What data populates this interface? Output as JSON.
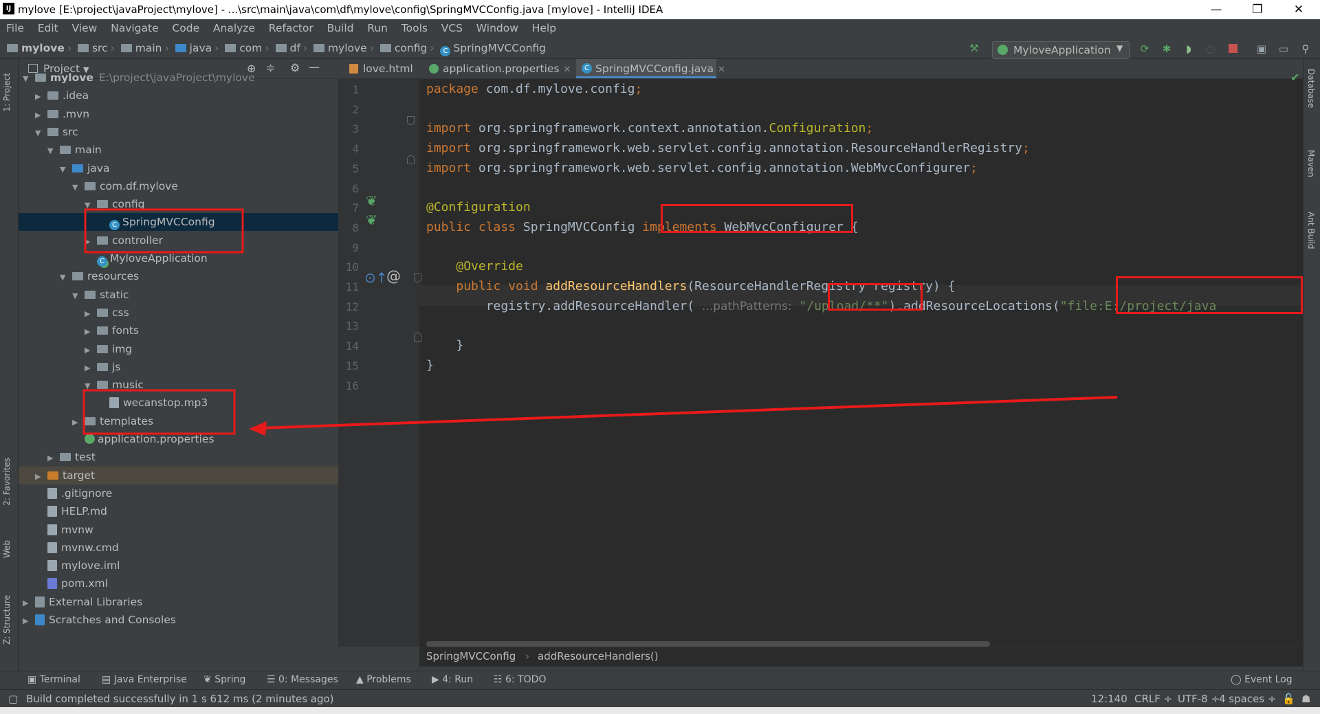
{
  "window": {
    "title": "mylove [E:\\project\\javaProject\\mylove] - ...\\src\\main\\java\\com\\df\\mylove\\config\\SpringMVCConfig.java [mylove] - IntelliJ IDEA",
    "minimize": "—",
    "restore": "❐",
    "close": "✕"
  },
  "menu": [
    "File",
    "Edit",
    "View",
    "Navigate",
    "Code",
    "Analyze",
    "Refactor",
    "Build",
    "Run",
    "Tools",
    "VCS",
    "Window",
    "Help"
  ],
  "breadcrumbs": [
    "mylove",
    "src",
    "main",
    "java",
    "com",
    "df",
    "mylove",
    "config",
    "SpringMVCConfig"
  ],
  "run_config": "MyloveApplication",
  "project_panel": {
    "title": "Project",
    "tree": [
      {
        "label": "mylove",
        "extra": "E:\\project\\javaProject\\mylove",
        "depth": 0,
        "arrow": "▼",
        "icon": "folder"
      },
      {
        "label": ".idea",
        "depth": 1,
        "arrow": "▶",
        "icon": "folder"
      },
      {
        "label": ".mvn",
        "depth": 1,
        "arrow": "▶",
        "icon": "folder"
      },
      {
        "label": "src",
        "depth": 1,
        "arrow": "▼",
        "icon": "folder"
      },
      {
        "label": "main",
        "depth": 2,
        "arrow": "▼",
        "icon": "folder"
      },
      {
        "label": "java",
        "depth": 3,
        "arrow": "▼",
        "icon": "folder-blue"
      },
      {
        "label": "com.df.mylove",
        "depth": 4,
        "arrow": "▼",
        "icon": "package"
      },
      {
        "label": "config",
        "depth": 5,
        "arrow": "▼",
        "icon": "package"
      },
      {
        "label": "SpringMVCConfig",
        "depth": 6,
        "arrow": "",
        "icon": "class",
        "selected": true
      },
      {
        "label": "controller",
        "depth": 5,
        "arrow": "▶",
        "icon": "package"
      },
      {
        "label": "MyloveApplication",
        "depth": 5,
        "arrow": "",
        "icon": "spring-class"
      },
      {
        "label": "resources",
        "depth": 3,
        "arrow": "▼",
        "icon": "folder"
      },
      {
        "label": "static",
        "depth": 4,
        "arrow": "▼",
        "icon": "folder"
      },
      {
        "label": "css",
        "depth": 5,
        "arrow": "▶",
        "icon": "folder"
      },
      {
        "label": "fonts",
        "depth": 5,
        "arrow": "▶",
        "icon": "folder"
      },
      {
        "label": "img",
        "depth": 5,
        "arrow": "▶",
        "icon": "folder"
      },
      {
        "label": "js",
        "depth": 5,
        "arrow": "▶",
        "icon": "folder"
      },
      {
        "label": "music",
        "depth": 5,
        "arrow": "▼",
        "icon": "folder"
      },
      {
        "label": "wecanstop.mp3",
        "depth": 6,
        "arrow": "",
        "icon": "file"
      },
      {
        "label": "templates",
        "depth": 4,
        "arrow": "▶",
        "icon": "folder"
      },
      {
        "label": "application.properties",
        "depth": 4,
        "arrow": "",
        "icon": "spring-file"
      },
      {
        "label": "test",
        "depth": 2,
        "arrow": "▶",
        "icon": "folder"
      },
      {
        "label": "target",
        "depth": 1,
        "arrow": "▶",
        "icon": "folder-orange",
        "target": true
      },
      {
        "label": ".gitignore",
        "depth": 1,
        "arrow": "",
        "icon": "file"
      },
      {
        "label": "HELP.md",
        "depth": 1,
        "arrow": "",
        "icon": "md-file"
      },
      {
        "label": "mvnw",
        "depth": 1,
        "arrow": "",
        "icon": "file"
      },
      {
        "label": "mvnw.cmd",
        "depth": 1,
        "arrow": "",
        "icon": "file"
      },
      {
        "label": "mylove.iml",
        "depth": 1,
        "arrow": "",
        "icon": "file"
      },
      {
        "label": "pom.xml",
        "depth": 1,
        "arrow": "",
        "icon": "maven-file"
      },
      {
        "label": "External Libraries",
        "depth": 0,
        "arrow": "▶",
        "icon": "libraries"
      },
      {
        "label": "Scratches and Consoles",
        "depth": 0,
        "arrow": "▶",
        "icon": "scratches"
      }
    ]
  },
  "editor_tabs": [
    {
      "label": "love.html",
      "active": false,
      "close": ""
    },
    {
      "label": "application.properties",
      "active": false,
      "close": "✕"
    },
    {
      "label": "SpringMVCConfig.java",
      "active": true,
      "close": "✕"
    }
  ],
  "code_lines": [
    {
      "n": "1",
      "parts": [
        [
          "kw",
          "package "
        ],
        [
          "",
          "com.df.mylove.config"
        ],
        [
          "kw",
          ";"
        ]
      ]
    },
    {
      "n": "2",
      "parts": []
    },
    {
      "n": "3",
      "parts": [
        [
          "kw",
          "import "
        ],
        [
          "",
          "org.springframework.context.annotation."
        ],
        [
          "ann",
          "Configuration"
        ],
        [
          "kw",
          ";"
        ]
      ]
    },
    {
      "n": "4",
      "parts": [
        [
          "kw",
          "import "
        ],
        [
          "",
          "org.springframework.web.servlet.config.annotation.ResourceHandlerRegistry"
        ],
        [
          "kw",
          ";"
        ]
      ]
    },
    {
      "n": "5",
      "parts": [
        [
          "kw",
          "import "
        ],
        [
          "",
          "org.springframework.web.servlet.config.annotation.WebMvcConfigurer"
        ],
        [
          "kw",
          ";"
        ]
      ]
    },
    {
      "n": "6",
      "parts": []
    },
    {
      "n": "7",
      "parts": [
        [
          "ann",
          "@Configuration"
        ]
      ]
    },
    {
      "n": "8",
      "parts": [
        [
          "kw",
          "public class "
        ],
        [
          "",
          "SpringMVCConfig "
        ],
        [
          "kw",
          "implements "
        ],
        [
          "",
          "WebMvcConfigurer {"
        ]
      ]
    },
    {
      "n": "9",
      "parts": []
    },
    {
      "n": "10",
      "parts": [
        [
          "",
          "    "
        ],
        [
          "ann",
          "@Override"
        ]
      ]
    },
    {
      "n": "11",
      "parts": [
        [
          "",
          "    "
        ],
        [
          "kw",
          "public void "
        ],
        [
          "fn",
          "addResourceHandlers"
        ],
        [
          "",
          "(ResourceHandlerRegistry registry) {"
        ]
      ]
    },
    {
      "n": "12",
      "parts": [
        [
          "",
          "        registry.addResourceHandler( "
        ],
        [
          "hint",
          "...pathPatterns:"
        ],
        [
          "str",
          " \"/upload/**\""
        ],
        [
          "",
          ").addResourceLocations("
        ],
        [
          "str",
          "\"file:E:/project/java"
        ]
      ]
    },
    {
      "n": "13",
      "parts": []
    },
    {
      "n": "14",
      "parts": [
        [
          "",
          "    }"
        ]
      ]
    },
    {
      "n": "15",
      "parts": [
        [
          "",
          "}"
        ]
      ]
    },
    {
      "n": "16",
      "parts": []
    }
  ],
  "gutter_icons": {
    "line11_override": "⊙↑",
    "line11_at": "@"
  },
  "editor_breadcrumbs": [
    "SpringMVCConfig",
    "addResourceHandlers()"
  ],
  "left_stripe": [
    "1: Project",
    "2: Favorites",
    "Web",
    "Z: Structure"
  ],
  "right_stripe": [
    "Database",
    "Maven",
    "Ant Build"
  ],
  "bottom_tabs": [
    "Terminal",
    "Java Enterprise",
    "Spring",
    "0: Messages",
    "Problems",
    "4: Run",
    "6: TODO",
    "Event Log"
  ],
  "status": {
    "message": "Build completed successfully in 1 s 612 ms (2 minutes ago)",
    "position": "12:140",
    "line_sep": "CRLF ÷",
    "encoding": "UTF-8 ÷",
    "indent": "4 spaces ÷"
  },
  "colors": {
    "keyword": "#cc7832",
    "annotation": "#bbb529",
    "string": "#6a8759",
    "highlight": "#e81a1a"
  }
}
